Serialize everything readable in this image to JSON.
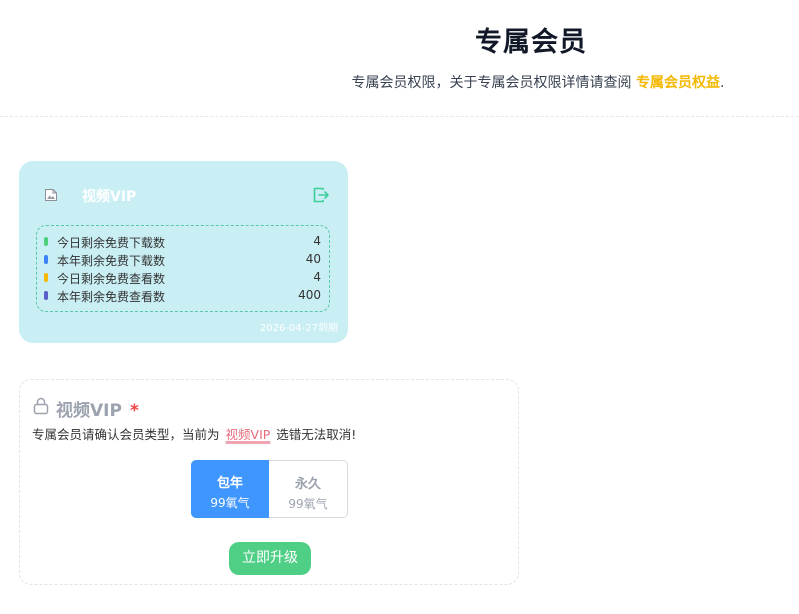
{
  "header": {
    "title": "专属会员",
    "subtitle_prefix": "专属会员权限，关于专属会员权限详情请查阅 ",
    "subtitle_link": "专属会员权益",
    "subtitle_suffix": "."
  },
  "vip_card": {
    "name": "视频VIP",
    "icons": {
      "image": "broken-image-icon",
      "exit": "exit-icon"
    },
    "stats": [
      {
        "label": "今日剩余免费下载数",
        "value": "4",
        "color": "#4cd07d"
      },
      {
        "label": "本年剩余免费下载数",
        "value": "40",
        "color": "#3b82f6"
      },
      {
        "label": "今日剩余免费查看数",
        "value": "4",
        "color": "#f5b800"
      },
      {
        "label": "本年剩余免费查看数",
        "value": "400",
        "color": "#5b5fc7"
      }
    ],
    "expire": "2026-04-27到期"
  },
  "form": {
    "title": "视频VIP",
    "required_mark": "*",
    "desc_prefix": "专属会员请确认会员类型，当前为",
    "desc_highlight": "视频VIP",
    "desc_suffix": "选错无法取消!",
    "options": [
      {
        "name": "包年",
        "price": "99氧气",
        "selected": true
      },
      {
        "name": "永久",
        "price": "99氧气",
        "selected": false
      }
    ],
    "submit_label": "立即升级"
  },
  "colors": {
    "accent": "#4096ff",
    "link": "#f5b800",
    "card_bg": "#c9eef3",
    "submit": "#4fcf86",
    "required": "#ef4444"
  }
}
